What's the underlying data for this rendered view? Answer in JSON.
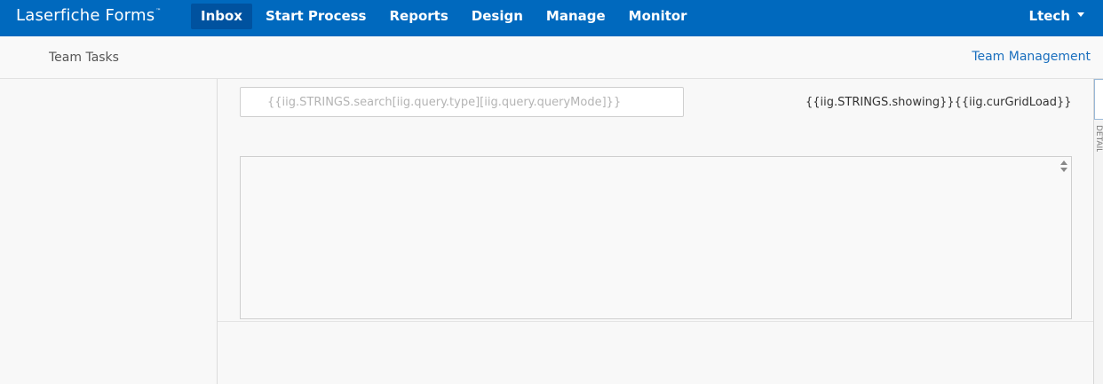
{
  "brand": {
    "name": "Laserfiche Forms",
    "tm": "™"
  },
  "nav": {
    "items": [
      {
        "label": "Inbox",
        "active": true
      },
      {
        "label": "Start Process"
      },
      {
        "label": "Reports"
      },
      {
        "label": "Design"
      },
      {
        "label": "Manage"
      },
      {
        "label": "Monitor"
      }
    ]
  },
  "user": {
    "name": "Ltech",
    "menu_icon": "caret-down-icon"
  },
  "subheader": {
    "title": "Team Tasks",
    "link": "Team Management"
  },
  "search": {
    "placeholder": "{{iig.STRINGS.search[iig.query.type][iig.query.queryMode]}}"
  },
  "status": {
    "showing": "{{iig.STRINGS.showing}}{{iig.curGridLoad}}"
  },
  "side_tab": {
    "label": "DETAILS"
  },
  "colors": {
    "topbar": "#0069be",
    "nav_active": "#00529f",
    "link": "#1a6fbe"
  }
}
